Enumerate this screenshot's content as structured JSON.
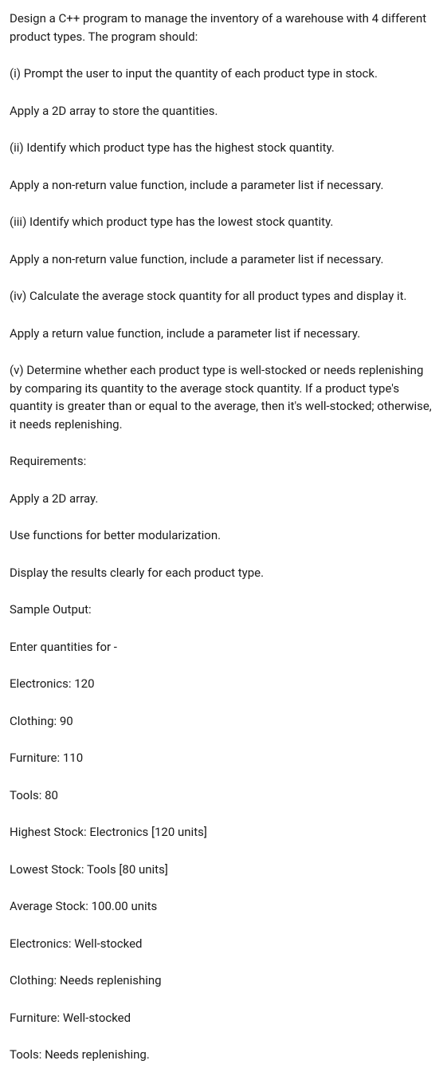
{
  "paragraphs": [
    "Design a C++ program to manage the inventory of a warehouse with 4 different product types. The program should:",
    "(i) Prompt the user to input the quantity of each product type in stock.",
    "Apply a 2D array to store the quantities.",
    "(ii) Identify which product type has the highest stock quantity.",
    "Apply a non-return value function, include a parameter list if necessary.",
    "(iii) Identify which product type has the lowest stock quantity.",
    "Apply a non-return value function, include a parameter list if necessary.",
    "(iv) Calculate the average stock quantity for all product types and display it.",
    "Apply a return value function, include a parameter list if necessary.",
    "(v) Determine whether each product type is well-stocked or needs replenishing by comparing its quantity to the average stock quantity. If a product type's quantity is greater than or equal to the average, then it's well-stocked; otherwise, it needs replenishing.",
    "Requirements:",
    "Apply a 2D array.",
    "Use functions for better modularization.",
    "Display the results clearly for each product type.",
    "Sample Output:",
    "Enter quantities for -",
    "Electronics: 120",
    "Clothing: 90",
    "Furniture: 110",
    "Tools: 80",
    "Highest Stock: Electronics [120 units]",
    "Lowest Stock: Tools [80 units]",
    "Average Stock: 100.00 units",
    "Electronics: Well-stocked",
    "Clothing: Needs replenishing",
    "Furniture: Well-stocked",
    "Tools: Needs replenishing."
  ]
}
